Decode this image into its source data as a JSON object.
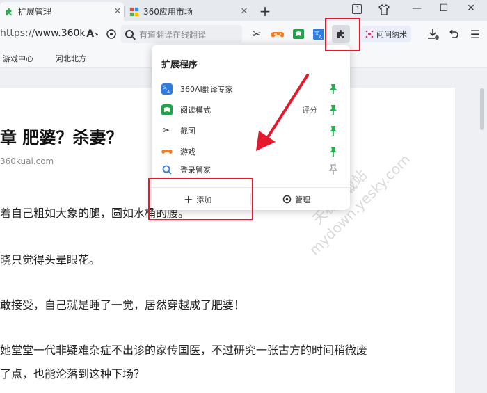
{
  "tabs": [
    {
      "title": "扩展管理",
      "close": "✕",
      "favicon": "puzzle-icon",
      "active": true
    },
    {
      "title": "360应用市场",
      "close": "✕",
      "favicon": "app-market-icon",
      "active": false
    }
  ],
  "window": {
    "new_tab": "+",
    "tab_count": "3",
    "minimize": "—",
    "maximize": "☐",
    "close": "✕"
  },
  "toolbar": {
    "url_prefix": "https://",
    "url_domain": "www.360k",
    "search_placeholder": "有道翻译在线翻译",
    "wenwen_label": "问问纳米"
  },
  "bookmarks": [
    "游戏中心",
    "河北北方"
  ],
  "article": {
    "heading": "章 肥婆？杀妻？",
    "source": "360kuai.com",
    "paragraphs": [
      "着自己粗如大象的腿，圆如水桶的腰。",
      "晓只觉得头晕眼花。",
      "敢接受，自己就是睡了一觉，居然穿越成了肥婆！",
      "她堂堂一代非疑难杂症不出诊的家传国医，不过研究一张古方的时间稍微废",
      "了点，也能沦落到这种下场？"
    ]
  },
  "extensions_popup": {
    "title": "扩展程序",
    "items": [
      {
        "name": "360AI翻译专家",
        "rating": "",
        "icon": "translate-icon",
        "pinned": true
      },
      {
        "name": "阅读模式",
        "rating": "评分",
        "icon": "reader-icon",
        "pinned": true
      },
      {
        "name": "截图",
        "rating": "",
        "icon": "scissors-icon",
        "pinned": true
      },
      {
        "name": "游戏",
        "rating": "",
        "icon": "gamepad-icon",
        "pinned": true
      },
      {
        "name": "登录管家",
        "rating": "",
        "icon": "login-icon",
        "pinned": false
      }
    ],
    "add_label": "添加",
    "manage_label": "管理"
  },
  "watermark": "天极下载站 mydown.yesky.com",
  "colors": {
    "pin_green": "#21b04b",
    "pin_gray": "#9a9a9a",
    "highlight_red": "#e8182c",
    "accent_blue": "#1f7ad6"
  }
}
